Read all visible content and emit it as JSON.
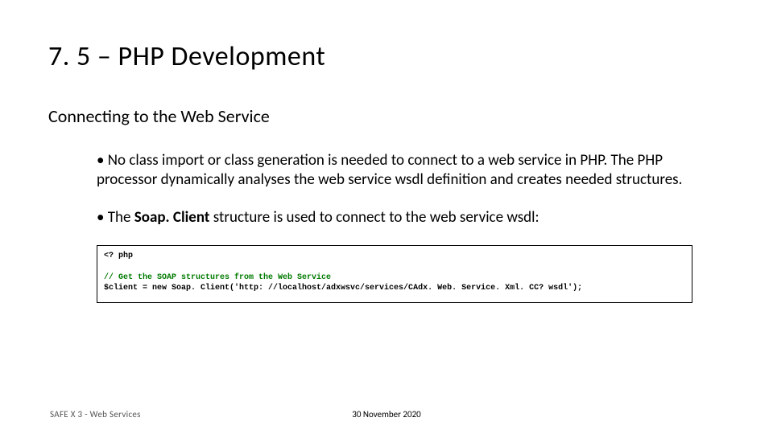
{
  "title": "7. 5 – PHP Development",
  "subtitle": "Connecting to the Web Service",
  "bullets": {
    "b1_prefix": "• ",
    "b1": "No class import or class generation is needed to connect to a web service in PHP. The PHP processor dynamically analyses the web service wsdl definition and creates needed structures.",
    "b2_prefix": "• ",
    "b2_lead": "The ",
    "b2_bold": "Soap. Client",
    "b2_tail": " structure is used to connect to the web service wsdl:"
  },
  "code": {
    "line1": "<? php",
    "line2": "",
    "line3": "// Get the SOAP structures from the Web Service",
    "line4": "$client = new Soap. Client('http: //localhost/adxwsvc/services/CAdx. Web. Service. Xml. CC? wsdl');"
  },
  "footer": {
    "left": "SAFE X 3 - Web Services",
    "date": "30 November 2020"
  }
}
